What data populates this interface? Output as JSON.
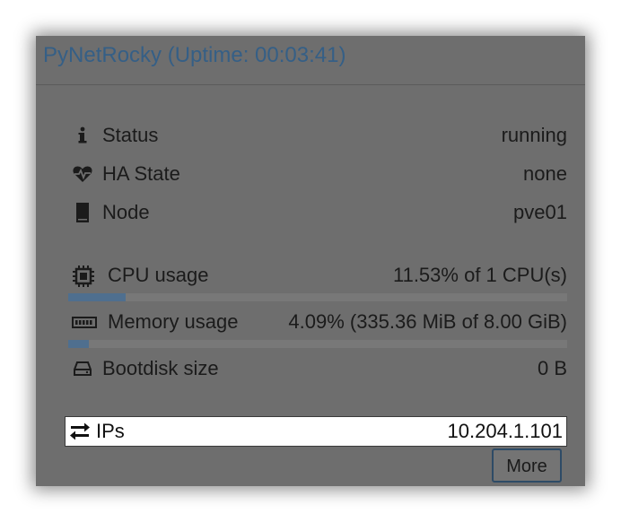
{
  "panel": {
    "title": "PyNetRocky (Uptime: 00:03:41)"
  },
  "rows": {
    "status": {
      "icon": "info-icon",
      "label": "Status",
      "value": "running"
    },
    "ha_state": {
      "icon": "heartbeat-icon",
      "label": "HA State",
      "value": "none"
    },
    "node": {
      "icon": "server-icon",
      "label": "Node",
      "value": "pve01"
    },
    "cpu": {
      "icon": "cpu-chip-icon",
      "label": "CPU usage",
      "value": "11.53% of 1 CPU(s)",
      "usage_fraction": 0.1153
    },
    "memory": {
      "icon": "memory-icon",
      "label": "Memory usage",
      "value": "4.09% (335.36 MiB of 8.00 GiB)",
      "usage_fraction": 0.0409
    },
    "bootdisk": {
      "icon": "hdd-icon",
      "label": "Bootdisk size",
      "value": "0 B"
    },
    "ips": {
      "icon": "exchange-icon",
      "label": "IPs",
      "value": "10.204.1.101"
    }
  },
  "more_button": {
    "label": "More"
  },
  "colors": {
    "panel_bg": "#6e6e6e",
    "title": "#355f86",
    "bar_fill": "#4f6f8f",
    "bar_track": "#787878"
  }
}
